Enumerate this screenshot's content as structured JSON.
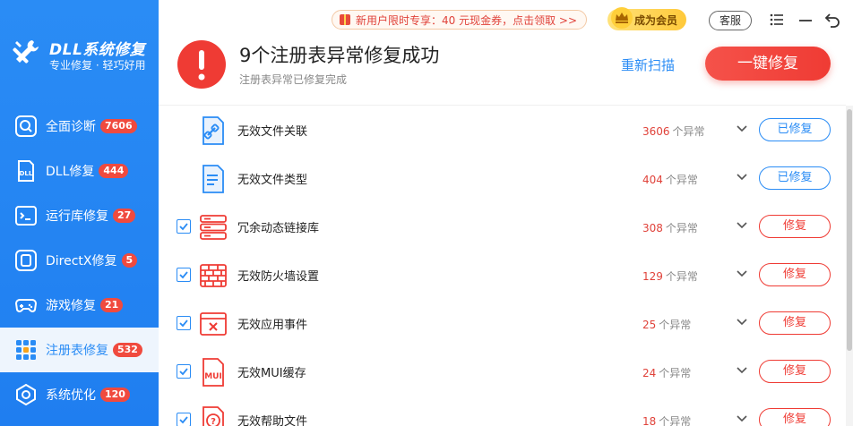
{
  "app": {
    "title": "DLL系统修复",
    "slogan": "专业修复 · 轻巧好用"
  },
  "topbar": {
    "promo_text": "新用户限时专享：40 元现金券，点击领取 >>",
    "vip_label": "成为会员",
    "service_label": "客服"
  },
  "sidebar": {
    "items": [
      {
        "label": "全面诊断",
        "badge": "7606",
        "icon": "search-scan-icon",
        "active": false
      },
      {
        "label": "DLL修复",
        "badge": "444",
        "icon": "dll-icon",
        "active": false
      },
      {
        "label": "运行库修复",
        "badge": "27",
        "icon": "runtime-icon",
        "active": false
      },
      {
        "label": "DirectX修复",
        "badge": "5",
        "icon": "directx-icon",
        "active": false
      },
      {
        "label": "游戏修复",
        "badge": "21",
        "icon": "gamepad-icon",
        "active": false
      },
      {
        "label": "注册表修复",
        "badge": "532",
        "icon": "registry-grid-icon",
        "active": true
      },
      {
        "label": "系统优化",
        "badge": "120",
        "icon": "optimize-icon",
        "active": false
      }
    ]
  },
  "header": {
    "title": "9个注册表异常修复成功",
    "subtitle": "注册表异常已修复完成",
    "rescan_label": "重新扫描",
    "fix_all_label": "一键修复"
  },
  "list": {
    "unit": "个异常",
    "rows": [
      {
        "label": "无效文件关联",
        "count": "3606",
        "status": "已修复",
        "checkbox": false,
        "icon": "file-link-icon",
        "state": "done"
      },
      {
        "label": "无效文件类型",
        "count": "404",
        "status": "已修复",
        "checkbox": false,
        "icon": "file-type-icon",
        "state": "done"
      },
      {
        "label": "冗余动态链接库",
        "count": "308",
        "status": "修复",
        "checkbox": true,
        "icon": "server-stack-icon",
        "state": "fix"
      },
      {
        "label": "无效防火墙设置",
        "count": "129",
        "status": "修复",
        "checkbox": true,
        "icon": "firewall-icon",
        "state": "fix"
      },
      {
        "label": "无效应用事件",
        "count": "25",
        "status": "修复",
        "checkbox": true,
        "icon": "app-error-window-icon",
        "state": "fix"
      },
      {
        "label": "无效MUI缓存",
        "count": "24",
        "status": "修复",
        "checkbox": true,
        "icon": "mui-file-icon",
        "state": "fix"
      },
      {
        "label": "无效帮助文件",
        "count": "18",
        "status": "修复",
        "checkbox": true,
        "icon": "help-file-icon",
        "state": "fix"
      }
    ]
  },
  "colors": {
    "accent_blue": "#2a8cf5",
    "danger_red": "#ef3b34",
    "badge_red": "#f04a3e"
  }
}
